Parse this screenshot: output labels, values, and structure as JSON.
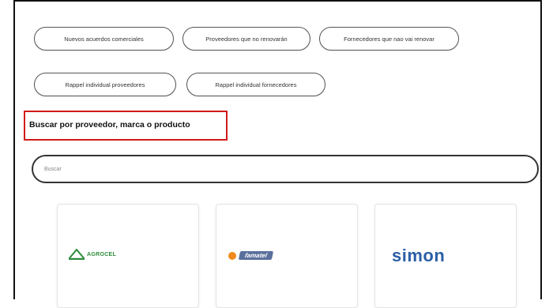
{
  "filters": [
    {
      "label": "Nuevos acuerdos comerciales"
    },
    {
      "label": "Proveedores que no renovarán"
    },
    {
      "label": "Fornecedores que nao vai renovar"
    },
    {
      "label": "Rappel individual proveedores"
    },
    {
      "label": "Rappel individual fornecedores"
    }
  ],
  "search": {
    "heading": "Buscar por proveedor, marca o producto",
    "placeholder": "Buscar"
  },
  "brands": [
    {
      "name": "AGROCEL",
      "color": "#2d8a3a"
    },
    {
      "name": "famatel",
      "color": "#5a6f9c",
      "accent": "#f08a1c"
    },
    {
      "name": "simon",
      "color": "#2b5fa6"
    }
  ]
}
